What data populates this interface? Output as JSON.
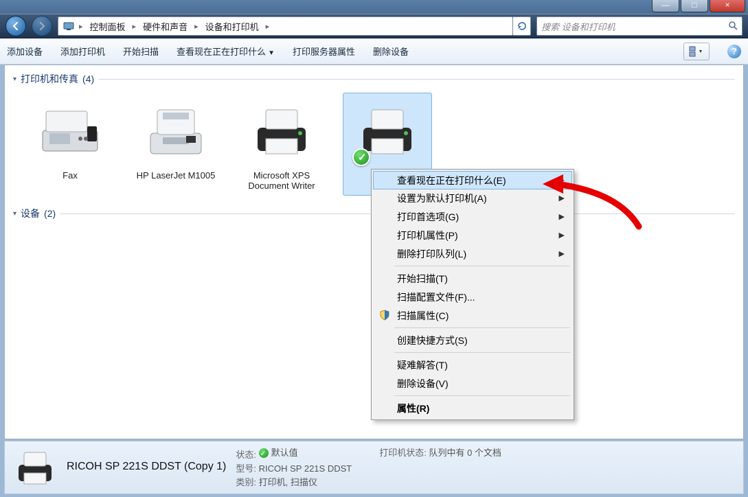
{
  "window": {
    "btn_min": "—",
    "btn_max": "□",
    "btn_close": "×"
  },
  "breadcrumb": {
    "items": [
      "控制面板",
      "硬件和声音",
      "设备和打印机"
    ]
  },
  "search": {
    "placeholder": "搜索 设备和打印机"
  },
  "toolbar": {
    "add_device": "添加设备",
    "add_printer": "添加打印机",
    "start_scan": "开始扫描",
    "view_printing": "查看现在正在打印什么",
    "server_props": "打印服务器属性",
    "remove_device": "删除设备"
  },
  "groups": {
    "printers": {
      "title": "打印机和传真",
      "count": "(4)"
    },
    "devices": {
      "title": "设备",
      "count": "(2)"
    }
  },
  "items": {
    "fax": "Fax",
    "hp": "HP LaserJet M1005",
    "xps": "Microsoft XPS Document Writer",
    "ricoh_line1": "RICOH",
    "ricoh_line2": "DDST ("
  },
  "context_menu": {
    "view_printing": "查看现在正在打印什么(E)",
    "set_default": "设置为默认打印机(A)",
    "print_prefs": "打印首选项(G)",
    "printer_props": "打印机属性(P)",
    "delete_queue": "删除打印队列(L)",
    "start_scan": "开始扫描(T)",
    "scan_profile": "扫描配置文件(F)...",
    "scan_props": "扫描属性(C)",
    "create_shortcut": "创建快捷方式(S)",
    "troubleshoot": "疑难解答(T)",
    "remove_device": "删除设备(V)",
    "properties": "属性(R)"
  },
  "status": {
    "name": "RICOH SP 221S DDST (Copy 1)",
    "state_label": "状态:",
    "state_value": "默认值",
    "model_label": "型号:",
    "model_value": "RICOH SP 221S DDST",
    "category_label": "类别:",
    "category_value": "打印机, 扫描仪",
    "queue_label": "打印机状态:",
    "queue_value": "队列中有 0 个文档"
  }
}
